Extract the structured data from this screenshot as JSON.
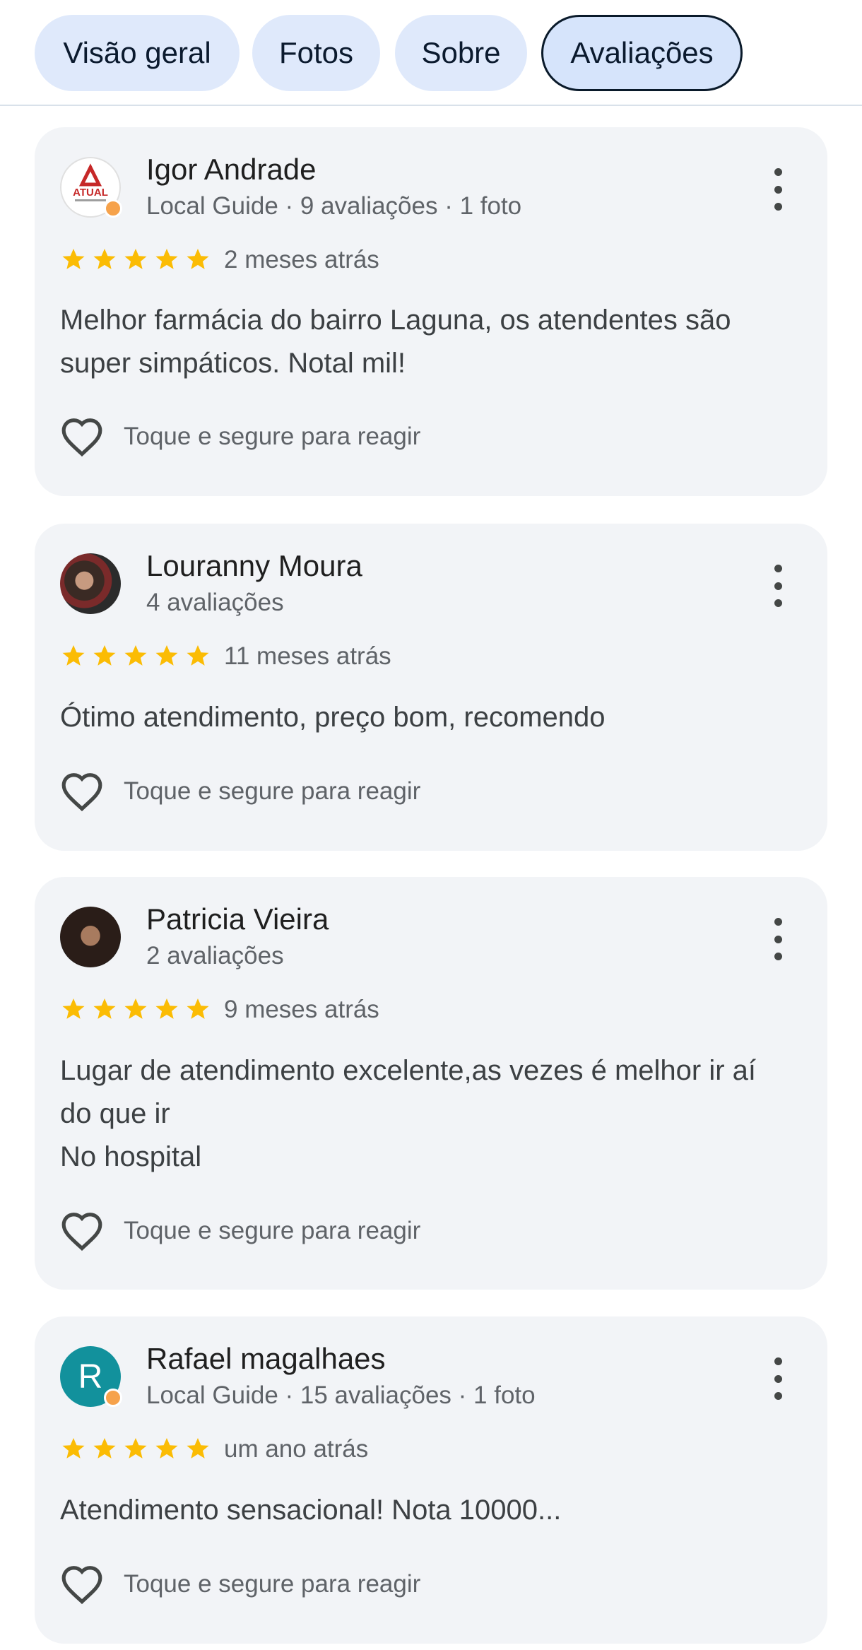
{
  "tabs": [
    {
      "label": "Visão geral"
    },
    {
      "label": "Fotos"
    },
    {
      "label": "Sobre"
    },
    {
      "label": "Avaliações",
      "active": true
    }
  ],
  "colors": {
    "star": "#fbbc04",
    "tab_bg": "#dfe9fb",
    "card_bg": "#f2f4f7",
    "secondary_text": "#5f6368"
  },
  "reviews": [
    {
      "name": "Igor Andrade",
      "meta": "Local Guide · 9 avaliações · 1 foto",
      "rating": 5,
      "time": "2 meses atrás",
      "text": "Melhor farmácia do bairro Laguna, os atendentes são\nsuper simpáticos. Notal mil!",
      "react_label": "Toque e segure para reagir",
      "avatar_logo": "ATUAL"
    },
    {
      "name": "Louranny Moura",
      "meta": "4 avaliações",
      "rating": 5,
      "time": "11 meses atrás",
      "text": "Ótimo atendimento, preço bom, recomendo",
      "react_label": "Toque e segure para reagir"
    },
    {
      "name": "Patricia Vieira",
      "meta": "2 avaliações",
      "rating": 5,
      "time": "9 meses atrás",
      "text": "Lugar de atendimento excelente,as vezes é melhor ir aí\ndo que ir\nNo hospital",
      "react_label": "Toque e segure para reagir"
    },
    {
      "name": "Rafael magalhaes",
      "meta": "Local Guide · 15 avaliações · 1 foto",
      "rating": 5,
      "time": "um ano atrás",
      "text": "Atendimento sensacional! Nota 10000...",
      "react_label": "Toque e segure para reagir",
      "avatar_letter": "R"
    }
  ]
}
